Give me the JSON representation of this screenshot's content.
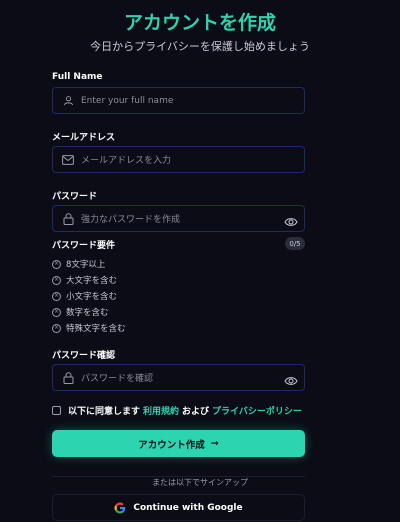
{
  "header": {
    "title": "アカウントを作成",
    "subtitle": "今日からプライバシーを保護し始めましょう"
  },
  "full_name": {
    "label": "Full Name",
    "placeholder": "Enter your full name",
    "icon": "user-icon"
  },
  "email": {
    "label": "メールアドレス",
    "placeholder": "メールアドレスを入力",
    "icon": "mail-icon"
  },
  "password": {
    "label": "パスワード",
    "placeholder": "強力なパスワードを作成",
    "icon": "lock-icon"
  },
  "requirements": {
    "label": "パスワード要件",
    "progress": "0/5",
    "items": [
      "8文字以上",
      "大文字を含む",
      "小文字を含む",
      "数字を含む",
      "特殊文字を含む"
    ]
  },
  "confirm": {
    "label": "パスワード確認",
    "placeholder": "パスワードを確認",
    "icon": "lock-icon"
  },
  "agreement": {
    "prefix": "以下に同意します",
    "terms_link": "利用規約",
    "conj": "および",
    "privacy_link": "プライバシーポリシー",
    "checked": false
  },
  "submit": {
    "label": "アカウント作成",
    "arrow": "→"
  },
  "alt_signup": {
    "divider_text": "または以下でサインアップ",
    "google_label": "Continue with Google"
  },
  "colors": {
    "accent": "#2dd4b0",
    "background": "#0b0c16",
    "field_border": "#1f2a66"
  }
}
